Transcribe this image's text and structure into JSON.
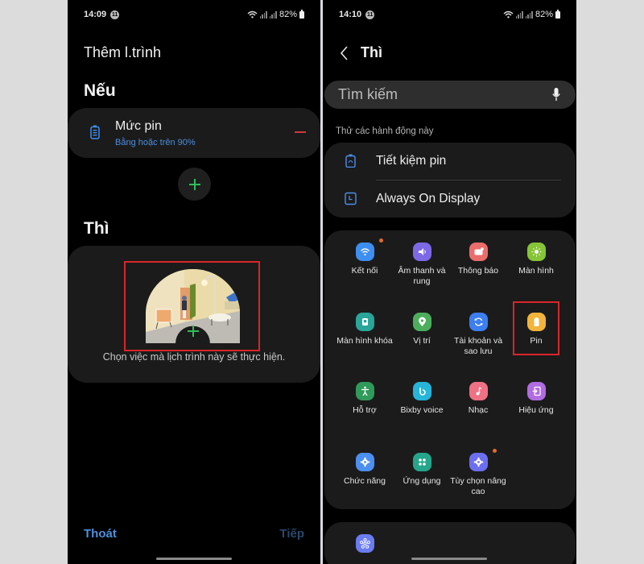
{
  "left_screen": {
    "status": {
      "time": "14:09",
      "notification_count": "11",
      "battery": "82%"
    },
    "title": "Thêm l.trình",
    "if_section": {
      "heading": "Nếu",
      "condition": {
        "icon": "battery-icon",
        "name": "Mức pin",
        "detail": "Bằng hoặc trên 90%",
        "remove_icon": "minus-icon"
      },
      "add_condition_icon": "plus-icon"
    },
    "then_section": {
      "heading": "Thì",
      "illustration": "room-illustration",
      "add_action_icon": "plus-icon",
      "hint": "Chọn việc mà lịch trình này sẽ thực hiện."
    },
    "footer": {
      "exit_label": "Thoát",
      "next_label": "Tiếp"
    }
  },
  "right_screen": {
    "status": {
      "time": "14:10",
      "notification_count": "11",
      "battery": "82%"
    },
    "title": "Thì",
    "search": {
      "placeholder": "Tìm kiếm",
      "value": ""
    },
    "suggestions_label": "Thử các hành động này",
    "suggestions": [
      {
        "icon": "battery-saver-icon",
        "label": "Tiết kiệm pin"
      },
      {
        "icon": "always-on-display-icon",
        "label": "Always On Display"
      }
    ],
    "categories": [
      {
        "icon": "wifi-icon",
        "label": "Kết nối",
        "color": "#3d8ef0",
        "badge": true
      },
      {
        "icon": "sound-icon",
        "label": "Âm thanh và rung",
        "color": "#7d68e6",
        "badge": false
      },
      {
        "icon": "notification-icon",
        "label": "Thông báo",
        "color": "#ea6d6b",
        "badge": false
      },
      {
        "icon": "display-icon",
        "label": "Màn hình",
        "color": "#86c536",
        "badge": false
      },
      {
        "icon": "lock-screen-icon",
        "label": "Màn hình khóa",
        "color": "#2aa59a",
        "badge": false
      },
      {
        "icon": "location-icon",
        "label": "Vị trí",
        "color": "#4cae5c",
        "badge": false
      },
      {
        "icon": "accounts-sync-icon",
        "label": "Tài khoản và sao lưu",
        "color": "#3d7ef0",
        "badge": false
      },
      {
        "icon": "battery-icon",
        "label": "Pin",
        "color": "#f2b43a",
        "badge": false
      },
      {
        "icon": "accessibility-icon",
        "label": "Hỗ trợ",
        "color": "#2f9a5a",
        "badge": false
      },
      {
        "icon": "bixby-icon",
        "label": "Bixby voice",
        "color": "#26b5d9",
        "badge": false
      },
      {
        "icon": "music-icon",
        "label": "Nhạc",
        "color": "#ef7184",
        "badge": false
      },
      {
        "icon": "effects-icon",
        "label": "Hiệu ứng",
        "color": "#b06ce0",
        "badge": false
      },
      {
        "icon": "gear-icon",
        "label": "Chức năng",
        "color": "#4c8ff0",
        "badge": false
      },
      {
        "icon": "apps-icon",
        "label": "Ứng dụng",
        "color": "#24a68c",
        "badge": false
      },
      {
        "icon": "advanced-gear-icon",
        "label": "Tùy chọn nâng cao",
        "color": "#6c6ff0",
        "badge": true
      }
    ],
    "highlighted_category": "Pin",
    "partial_item_icon": "flower-icon"
  }
}
